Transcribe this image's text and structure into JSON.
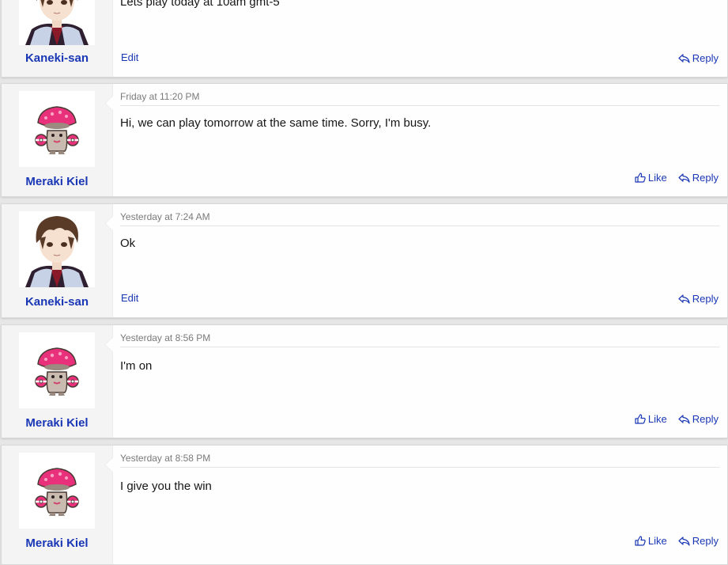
{
  "thread": {
    "posts": [
      {
        "author": "Kaneki-san",
        "avatar": "anime-boy-avatar",
        "date": "",
        "message": "Lets play today at 10am gmt-5",
        "own_post": true,
        "edit_label": "Edit",
        "reply_label": "Reply"
      },
      {
        "author": "Meraki Kiel",
        "avatar": "mushroom-pokemon-avatar",
        "date": "Friday at 11:20 PM",
        "message": "Hi, we can play tomorrow at the same time. Sorry, I'm busy.",
        "own_post": false,
        "like_label": "Like",
        "reply_label": "Reply"
      },
      {
        "author": "Kaneki-san",
        "avatar": "anime-boy-avatar",
        "date": "Yesterday at 7:24 AM",
        "message": "Ok",
        "own_post": true,
        "edit_label": "Edit",
        "reply_label": "Reply"
      },
      {
        "author": "Meraki Kiel",
        "avatar": "mushroom-pokemon-avatar",
        "date": "Yesterday at 8:56 PM",
        "message": "I'm on",
        "own_post": false,
        "like_label": "Like",
        "reply_label": "Reply"
      },
      {
        "author": "Meraki Kiel",
        "avatar": "mushroom-pokemon-avatar",
        "date": "Yesterday at 8:58 PM",
        "message": "I give you the win",
        "own_post": false,
        "like_label": "Like",
        "reply_label": "Reply"
      }
    ]
  },
  "colors": {
    "link": "#1a37b5",
    "date_text": "#7a7a7a",
    "body_text": "#161616",
    "page_background": "#e6e6e6",
    "user_panel": "#f4f4f4",
    "mushroom_cap": "#e8317a"
  },
  "icons": {
    "like": "thumbs-up-icon",
    "reply": "reply-arrow-icon"
  }
}
